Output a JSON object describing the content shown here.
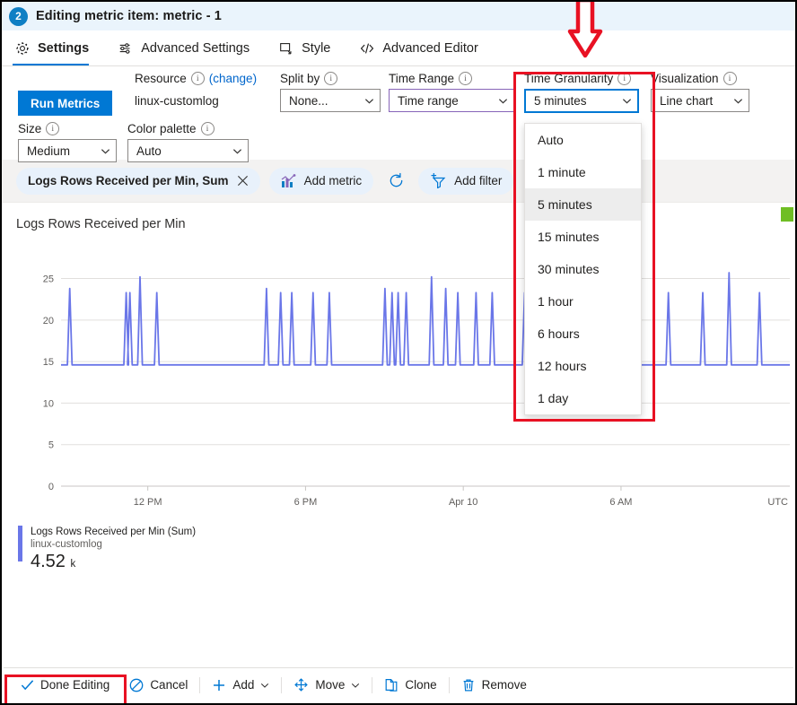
{
  "header": {
    "badge": "2",
    "title": "Editing metric item: metric - 1"
  },
  "tabs": [
    {
      "label": "Settings",
      "icon": "gear-icon",
      "active": true
    },
    {
      "label": "Advanced Settings",
      "icon": "sliders-icon",
      "active": false
    },
    {
      "label": "Style",
      "icon": "style-icon",
      "active": false
    },
    {
      "label": "Advanced Editor",
      "icon": "code-icon",
      "active": false
    }
  ],
  "settings": {
    "run_metrics_label": "Run Metrics",
    "resource": {
      "label": "Resource",
      "change_link": "(change)",
      "value": "linux-customlog"
    },
    "split_by": {
      "label": "Split by",
      "value": "None..."
    },
    "time_range": {
      "label": "Time Range",
      "value": "Time range"
    },
    "time_granularity": {
      "label": "Time Granularity",
      "value": "5 minutes",
      "options": [
        "Auto",
        "1 minute",
        "5 minutes",
        "15 minutes",
        "30 minutes",
        "1 hour",
        "6 hours",
        "12 hours",
        "1 day"
      ],
      "selected_index": 2
    },
    "visualization": {
      "label": "Visualization",
      "value": "Line chart"
    },
    "size": {
      "label": "Size",
      "value": "Medium"
    },
    "color_palette": {
      "label": "Color palette",
      "value": "Auto"
    }
  },
  "chips": {
    "metric_chip": "Logs Rows Received per Min, Sum",
    "add_metric": "Add metric",
    "refresh": "refresh-icon",
    "add_filter": "Add filter"
  },
  "chart_data": {
    "type": "line",
    "title": "Logs Rows Received per Min",
    "xlabel": "",
    "ylabel": "",
    "ylim": [
      0,
      27
    ],
    "yticks": [
      0,
      5,
      10,
      15,
      20,
      25
    ],
    "xticks": [
      "12 PM",
      "6 PM",
      "Apr 10",
      "6 AM"
    ],
    "timezone_label": "UTC",
    "grid": true,
    "series": [
      {
        "name": "Logs Rows Received per Min (Sum)",
        "color": "#6a76e8",
        "baseline": 14.6,
        "spikes_x_pct": [
          4.3,
          32.2,
          34.0,
          39.0,
          47.3,
          101.5,
          108.5,
          114.0,
          124.5,
          132.5,
          160.0,
          163.5,
          166.5,
          170.5,
          183.0,
          190.0,
          196.0,
          205.0,
          213.0,
          229.0,
          236.0,
          245.0,
          251.0,
          300.0,
          317.0,
          330.0,
          345.0
        ]
      }
    ]
  },
  "legend": {
    "title": "Logs Rows Received per Min (Sum)",
    "subtitle": "linux-customlog",
    "value": "4.52",
    "unit": "k"
  },
  "commands": [
    {
      "label": "Done Editing",
      "icon": "check-icon"
    },
    {
      "label": "Cancel",
      "icon": "cancel-icon"
    },
    {
      "label": "Add",
      "icon": "plus-icon",
      "caret": true
    },
    {
      "label": "Move",
      "icon": "move-icon",
      "caret": true
    },
    {
      "label": "Clone",
      "icon": "clone-icon"
    },
    {
      "label": "Remove",
      "icon": "trash-icon"
    }
  ],
  "colors": {
    "accent": "#0078d4",
    "annotation": "#e81123",
    "series": "#6a76e8",
    "purple_border": "#8764b8",
    "green_marker": "#6fbe24"
  }
}
